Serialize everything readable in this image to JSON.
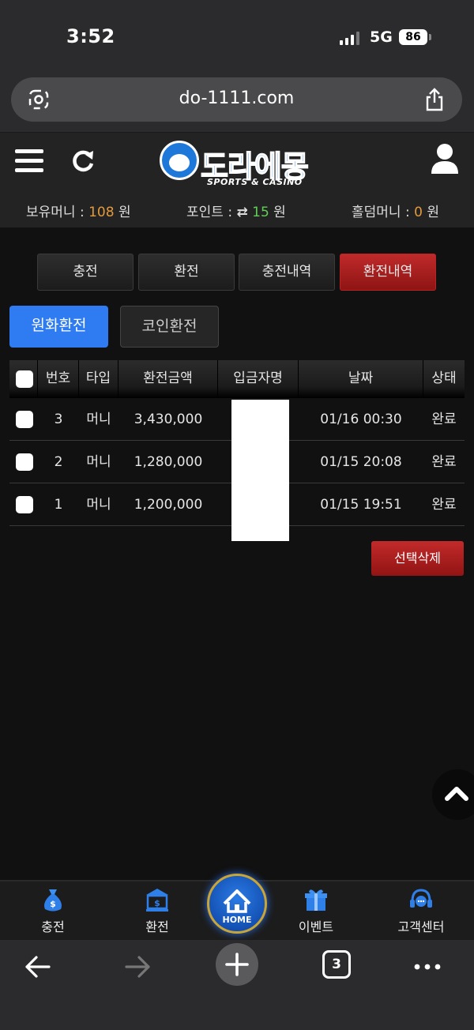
{
  "status_bar": {
    "time": "3:52",
    "network": "5G",
    "battery": "86"
  },
  "browser": {
    "url": "do-1111.com",
    "tab_count": "3"
  },
  "site": {
    "logo_text": "도라에몽",
    "logo_subtitle": "SPORTS & CASINO",
    "balances": {
      "money_label": "보유머니 :",
      "money_value": "108",
      "money_unit": "원",
      "point_label": "포인트 :",
      "point_value": "15",
      "point_unit": "원",
      "holdem_label": "홀덤머니 :",
      "holdem_value": "0",
      "holdem_unit": "원"
    }
  },
  "tabs": [
    {
      "label": "충전",
      "active": false
    },
    {
      "label": "환전",
      "active": false
    },
    {
      "label": "충전내역",
      "active": false
    },
    {
      "label": "환전내역",
      "active": true
    }
  ],
  "subtabs": {
    "won": "원화환전",
    "coin": "코인환전"
  },
  "table": {
    "headers": [
      "번호",
      "타입",
      "환전금액",
      "입금자명",
      "날짜",
      "상태"
    ],
    "rows": [
      {
        "no": "3",
        "type": "머니",
        "amount": "3,430,000",
        "name": "",
        "date": "01/16 00:30",
        "status": "완료"
      },
      {
        "no": "2",
        "type": "머니",
        "amount": "1,280,000",
        "name": "",
        "date": "01/15 20:08",
        "status": "완료"
      },
      {
        "no": "1",
        "type": "머니",
        "amount": "1,200,000",
        "name": "",
        "date": "01/15 19:51",
        "status": "완료"
      }
    ]
  },
  "delete_button": "선택삭제",
  "bottom_nav": {
    "charge": "충전",
    "exchange": "환전",
    "home": "HOME",
    "event": "이벤트",
    "support": "고객센터"
  },
  "colors": {
    "accent_red": "#a81c1c",
    "accent_blue": "#2f7cf2",
    "orange": "#e29a3c",
    "green": "#5fcf56"
  }
}
